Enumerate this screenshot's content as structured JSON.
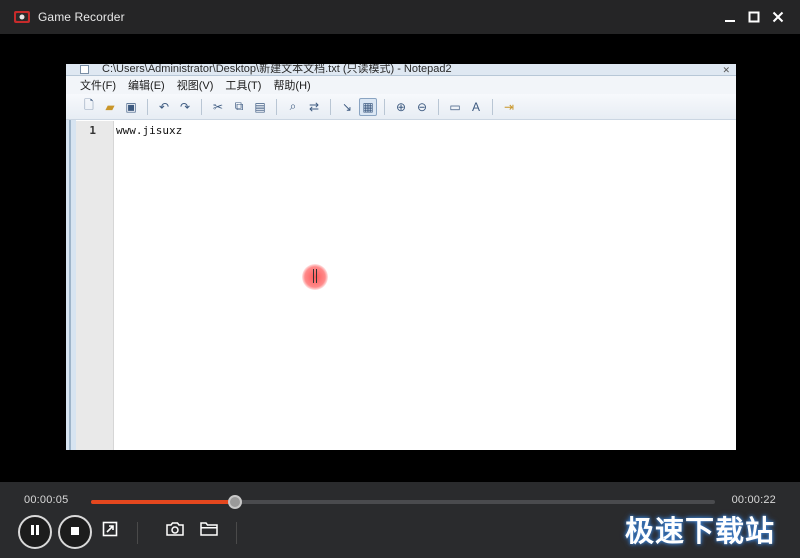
{
  "window": {
    "title": "Game Recorder",
    "controls": {
      "minimize": "—",
      "maximize": "◻",
      "close": "✕"
    }
  },
  "recording": {
    "notepad_title": "C:\\Users\\Administrator\\Desktop\\新建文本文档.txt (只读模式) - Notepad2",
    "menu": [
      "文件(F)",
      "编辑(E)",
      "视图(V)",
      "工具(T)",
      "帮助(H)"
    ],
    "line_number": "1",
    "line_text": "www.jisuxz"
  },
  "player": {
    "current_time": "00:00:05",
    "total_time": "00:00:22",
    "progress": 0.23,
    "accent_color": "#e4471e"
  },
  "icons": {
    "pause": "pause-icon",
    "stop": "stop-icon",
    "export": "export-icon",
    "snapshot": "camera-icon",
    "folder": "folder-icon"
  },
  "watermark": "极速下载站"
}
